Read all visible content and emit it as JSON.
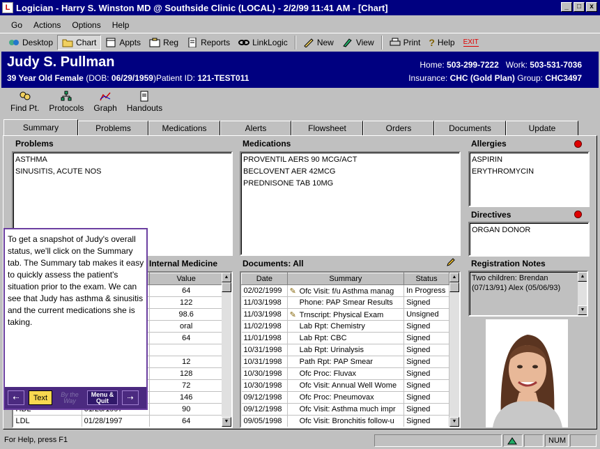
{
  "window": {
    "title": "Logician  -  Harry S. Winston MD @ Southside Clinic (LOCAL)  -  2/2/99  11:41 AM - [Chart]",
    "controls": [
      "_",
      "□",
      "x"
    ]
  },
  "menu": {
    "items": [
      "Go",
      "Actions",
      "Options",
      "Help"
    ]
  },
  "toolbar": {
    "desktop": "Desktop",
    "chart": "Chart",
    "appts": "Appts",
    "reg": "Reg",
    "reports": "Reports",
    "linklogic": "LinkLogic",
    "new": "New",
    "view": "View",
    "print": "Print",
    "help": "Help",
    "exit": "EXIT"
  },
  "patient": {
    "name": "Judy S. Pullman",
    "summary": "39 Year Old Female",
    "dob_label": "(DOB:",
    "dob": "06/29/1959",
    "dob_close": ")",
    "id_label": "Patient ID:",
    "id": "121-TEST011",
    "home_label": "Home:",
    "home": "503-299-7222",
    "work_label": "Work:",
    "work": "503-531-7036",
    "ins_label": "Insurance:",
    "insurance": "CHC (Gold Plan)",
    "group_label": "Group:",
    "group": "CHC3497"
  },
  "toolbar2": {
    "find": "Find Pt.",
    "protocols": "Protocols",
    "graph": "Graph",
    "handouts": "Handouts"
  },
  "tabs": [
    "Summary",
    "Problems",
    "Medications",
    "Alerts",
    "Flowsheet",
    "Orders",
    "Documents",
    "Update"
  ],
  "problems": {
    "title": "Problems",
    "items": [
      "ASTHMA",
      "SINUSITIS, ACUTE NOS"
    ]
  },
  "medications": {
    "title": "Medications",
    "items": [
      "PROVENTIL AERS 90 MCG/ACT",
      "BECLOVENT AER 42MCG",
      "PREDNISONE TAB 10MG"
    ]
  },
  "allergies": {
    "title": "Allergies",
    "items": [
      "ASPIRIN",
      "ERYTHROMYCIN"
    ]
  },
  "directives": {
    "title": "Directives",
    "items": [
      "ORGAN DONOR"
    ]
  },
  "flowsheet": {
    "title": "Internal Medicine",
    "headers": [
      "",
      "Value"
    ],
    "rows": [
      {
        "name": "",
        "date": "",
        "value": "64"
      },
      {
        "name": "",
        "date": "",
        "value": "122"
      },
      {
        "name": "",
        "date": "",
        "value": "98.6"
      },
      {
        "name": "",
        "date": "",
        "value": "oral"
      },
      {
        "name": "",
        "date": "",
        "value": "64"
      },
      {
        "name": "",
        "date": "",
        "value": ""
      },
      {
        "name": "",
        "date": "",
        "value": "12"
      },
      {
        "name": "",
        "date": "",
        "value": "128"
      },
      {
        "name": "",
        "date": "",
        "value": "72"
      },
      {
        "name": "",
        "date": "",
        "value": "146"
      },
      {
        "name": "HDL",
        "date": "01/28/1997",
        "value": "90"
      },
      {
        "name": "LDL",
        "date": "01/28/1997",
        "value": "64"
      }
    ]
  },
  "documents": {
    "title": "Documents:  All",
    "headers": [
      "Date",
      "Summary",
      "Status"
    ],
    "rows": [
      {
        "date": "02/02/1999",
        "summary": "Ofc Visit: f/u Asthma manag",
        "status": "In Progress",
        "pen": true
      },
      {
        "date": "11/03/1998",
        "summary": "Phone: PAP Smear Results",
        "status": "Signed",
        "pen": false
      },
      {
        "date": "11/03/1998",
        "summary": "Trnscript: Physical Exam",
        "status": "Unsigned",
        "pen": true
      },
      {
        "date": "11/02/1998",
        "summary": "Lab Rpt: Chemistry",
        "status": "Signed",
        "pen": false
      },
      {
        "date": "11/01/1998",
        "summary": "Lab Rpt: CBC",
        "status": "Signed",
        "pen": false
      },
      {
        "date": "10/31/1998",
        "summary": "Lab Rpt: Urinalysis",
        "status": "Signed",
        "pen": false
      },
      {
        "date": "10/31/1998",
        "summary": "Path Rpt: PAP Smear",
        "status": "Signed",
        "pen": false
      },
      {
        "date": "10/30/1998",
        "summary": "Ofc Proc: Fluvax",
        "status": "Signed",
        "pen": false
      },
      {
        "date": "10/30/1998",
        "summary": "Ofc Visit: Annual Well Wome",
        "status": "Signed",
        "pen": false
      },
      {
        "date": "09/12/1998",
        "summary": "Ofc Proc: Pneumovax",
        "status": "Signed",
        "pen": false
      },
      {
        "date": "09/12/1998",
        "summary": "Ofc Visit: Asthma much impr",
        "status": "Signed",
        "pen": false
      },
      {
        "date": "09/05/1998",
        "summary": "Ofc Visit: Bronchitis follow-u",
        "status": "Signed",
        "pen": false
      }
    ]
  },
  "registration": {
    "title": "Registration Notes",
    "text": "Two children: Brendan (07/13/91) Alex (05/06/93)"
  },
  "tip": {
    "text": "To get a snapshot of Judy's overall status, we'll click on the Summary tab. The Summary tab makes it easy to quickly assess the patient's situation prior to the exam. We can see that Judy has asthma & sinusitis and the current medications she is taking.",
    "text_button": "Text",
    "by_the_way": "By the Way",
    "menu_quit": "Menu & Quit"
  },
  "status": {
    "help": "For Help, press F1",
    "num": "NUM"
  },
  "colors": {
    "banner": "#000080",
    "accent_red": "#e00000",
    "tip_border": "#6b3fa0"
  }
}
